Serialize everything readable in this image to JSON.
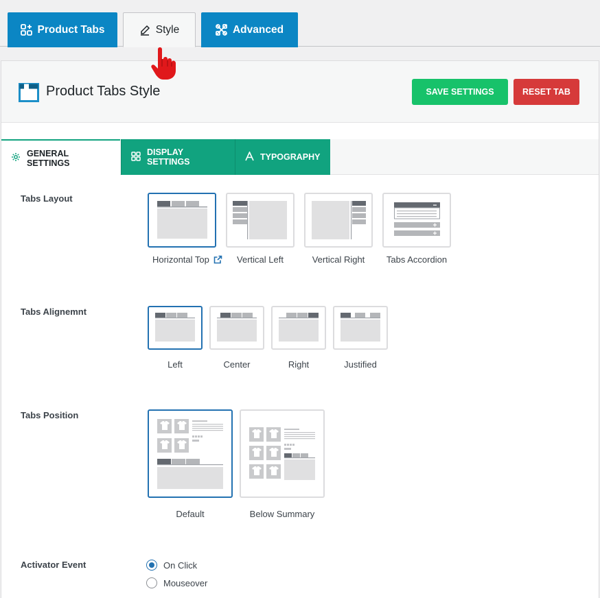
{
  "top_tabs": [
    {
      "label": "Product Tabs",
      "icon": "apps-plus-icon"
    },
    {
      "label": "Style",
      "icon": "pen-icon",
      "active": true
    },
    {
      "label": "Advanced",
      "icon": "tools-icon"
    }
  ],
  "header": {
    "title": "Product Tabs Style",
    "save_label": "SAVE SETTINGS",
    "reset_label": "RESET TAB"
  },
  "sub_tabs": [
    {
      "label": "GENERAL SETTINGS",
      "icon": "gear-icon",
      "active": true
    },
    {
      "label": "DISPLAY SETTINGS",
      "icon": "grid-icon"
    },
    {
      "label": "TYPOGRAPHY",
      "icon": "typography-icon"
    }
  ],
  "tabs_layout": {
    "label": "Tabs Layout",
    "options": [
      "Horizontal Top",
      "Vertical Left",
      "Vertical Right",
      "Tabs Accordion"
    ],
    "selected": "Horizontal Top"
  },
  "tabs_alignment": {
    "label": "Tabs Alignemnt",
    "options": [
      "Left",
      "Center",
      "Right",
      "Justified"
    ],
    "selected": "Left"
  },
  "tabs_position": {
    "label": "Tabs Position",
    "options": [
      "Default",
      "Below Summary"
    ],
    "selected": "Default"
  },
  "activator_event": {
    "label": "Activator Event",
    "options": [
      "On Click",
      "Mouseover"
    ],
    "selected": "On Click"
  },
  "colors": {
    "blue_tab": "#0b86c4",
    "green": "#11a37f",
    "save": "#17c26a",
    "reset": "#d63a3a",
    "selected_border": "#2271b1"
  }
}
